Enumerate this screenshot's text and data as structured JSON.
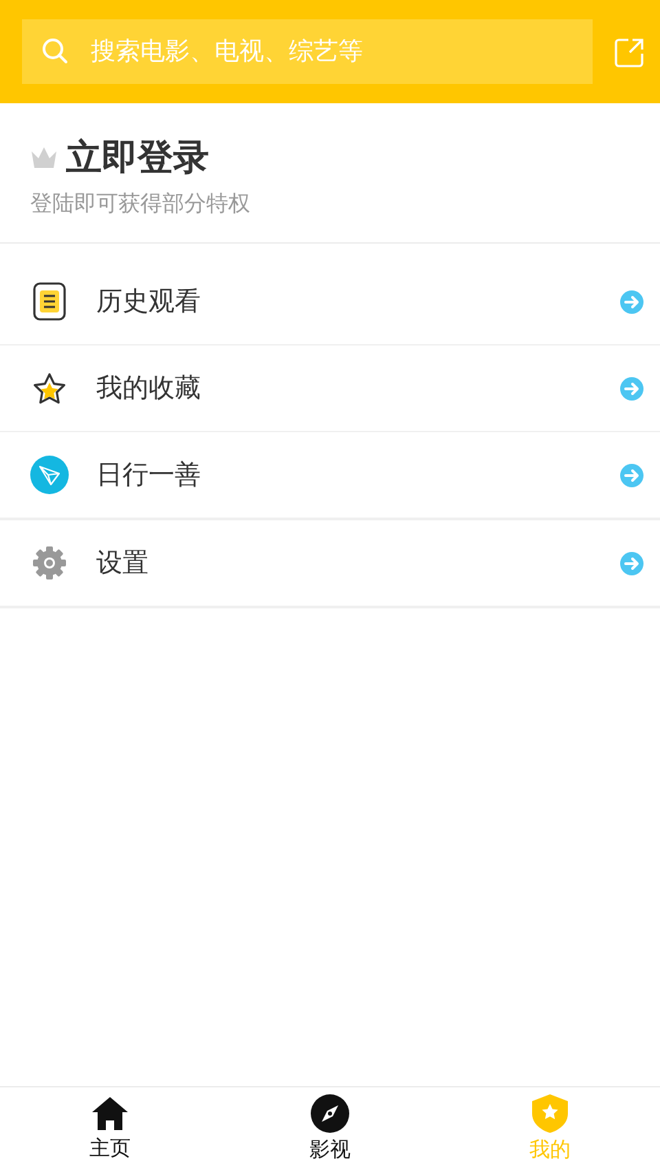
{
  "search": {
    "placeholder": "搜索电影、电视、综艺等"
  },
  "login": {
    "title": "立即登录",
    "subtitle": "登陆即可获得部分特权"
  },
  "menu": [
    {
      "kind": "history",
      "label": "历史观看"
    },
    {
      "kind": "favorites",
      "label": "我的收藏"
    },
    {
      "kind": "charity",
      "label": "日行一善"
    },
    {
      "kind": "settings",
      "label": "设置"
    }
  ],
  "tabs": [
    {
      "kind": "home",
      "label": "主页",
      "selected": false
    },
    {
      "kind": "discover",
      "label": "影视",
      "selected": false
    },
    {
      "kind": "mine",
      "label": "我的",
      "selected": true
    }
  ]
}
